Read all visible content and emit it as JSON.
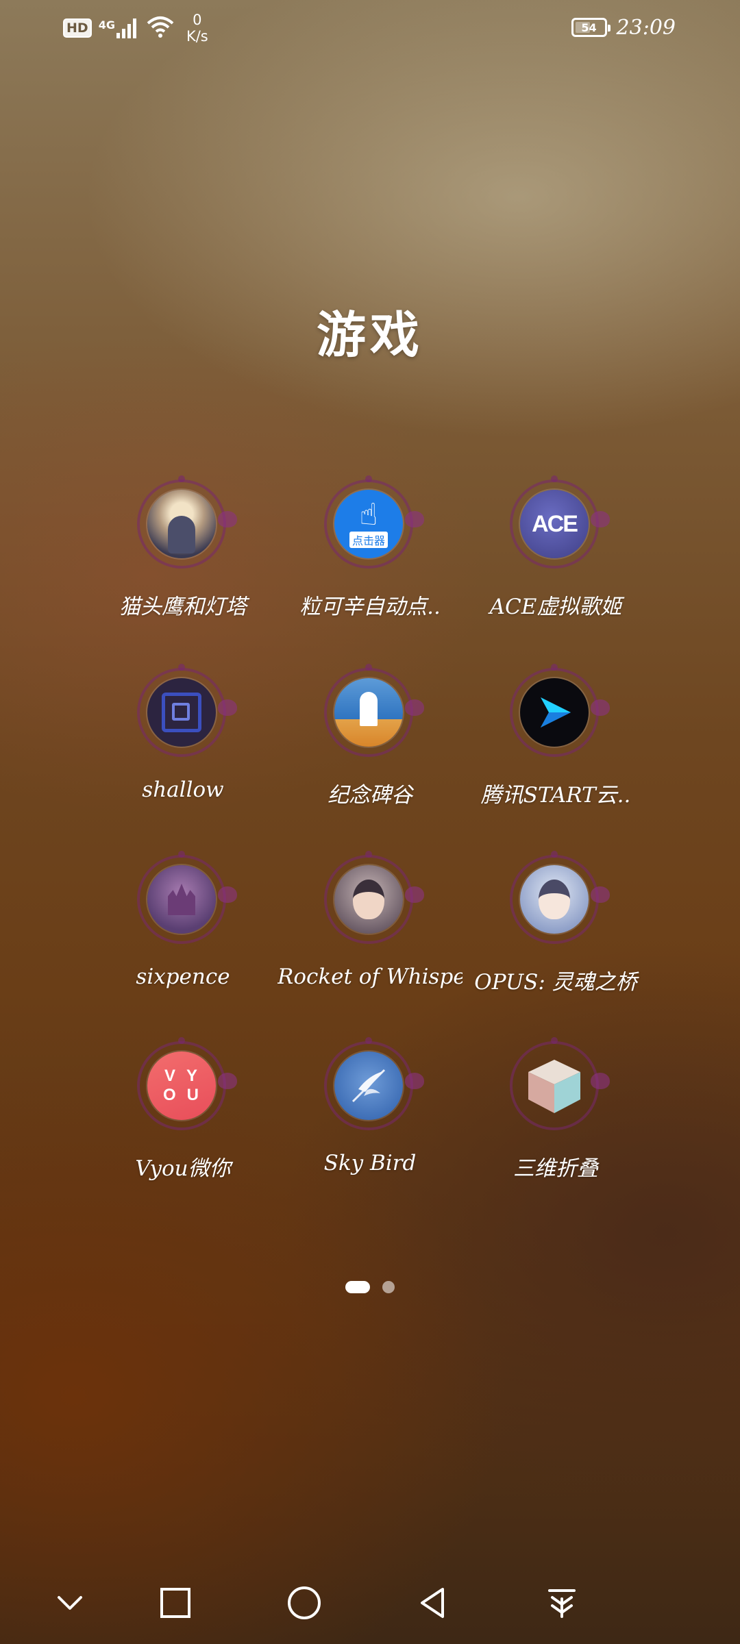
{
  "status_bar": {
    "hd_label": "HD",
    "network_type": "4G",
    "speed_value": "0",
    "speed_unit": "K/s",
    "battery_level": "54",
    "time": "23:09"
  },
  "folder": {
    "title": "游戏"
  },
  "apps": [
    {
      "label": "猫头鹰和灯塔",
      "icon": "owl-lighthouse-icon"
    },
    {
      "label": "粒可辛自动点..",
      "icon": "auto-clicker-icon"
    },
    {
      "label": "ACE虚拟歌姬",
      "icon": "ace-icon"
    },
    {
      "label": "shallow",
      "icon": "shallow-icon"
    },
    {
      "label": "纪念碑谷",
      "icon": "monument-valley-icon"
    },
    {
      "label": "腾讯START云..",
      "icon": "tencent-start-icon"
    },
    {
      "label": "sixpence",
      "icon": "sixpence-icon"
    },
    {
      "label": "Rocket of Whispe..",
      "icon": "rocket-of-whispers-icon"
    },
    {
      "label": "OPUS: 灵魂之桥",
      "icon": "opus-icon"
    },
    {
      "label": "Vyou微你",
      "icon": "vyou-icon"
    },
    {
      "label": "Sky Bird",
      "icon": "sky-bird-icon"
    },
    {
      "label": "三维折叠",
      "icon": "3d-fold-icon"
    }
  ],
  "icon_text": {
    "clicker_tag": "点击器",
    "ace_text": "ACE",
    "vyou_top": "VY",
    "vyou_bottom": "OU"
  },
  "pager": {
    "pages": 2,
    "current": 1
  },
  "nav_bar": {
    "buttons": [
      "collapse-icon",
      "recents-icon",
      "home-icon",
      "back-icon",
      "notification-pull-icon"
    ]
  },
  "colors": {
    "ring": "#782e6e",
    "text": "#ffffff"
  }
}
